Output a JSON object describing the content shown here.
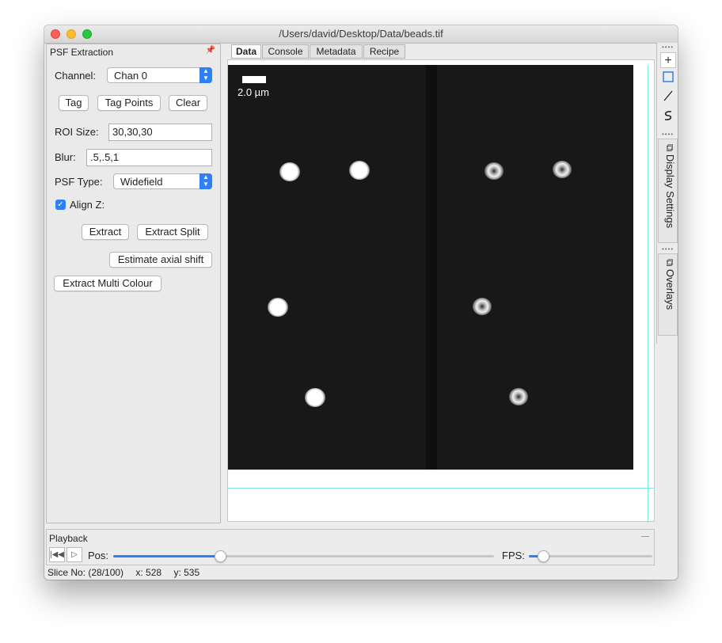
{
  "window": {
    "title": "/Users/david/Desktop/Data/beads.tif"
  },
  "psf_panel": {
    "title": "PSF Extraction",
    "pin_icon": "pin-icon",
    "channel_label": "Channel:",
    "channel_value": "Chan 0",
    "tag_label": "Tag",
    "tag_points_label": "Tag Points",
    "clear_label": "Clear",
    "roi_label": "ROI Size:",
    "roi_value": "30,30,30",
    "blur_label": "Blur:",
    "blur_value": ".5,.5,1",
    "psf_type_label": "PSF Type:",
    "psf_type_value": "Widefield",
    "align_z_label": "Align Z:",
    "align_z_checked": true,
    "extract_label": "Extract",
    "extract_split_label": "Extract Split",
    "estimate_label": "Estimate axial shift",
    "multi_colour_label": "Extract Multi Colour"
  },
  "tabs": [
    "Data",
    "Console",
    "Metadata",
    "Recipe"
  ],
  "active_tab": "Data",
  "image": {
    "scale_label": "2.0 µm"
  },
  "side_tools": [
    "crosshair-icon",
    "rectangle-icon",
    "line-icon",
    "curve-icon"
  ],
  "side_tabs": [
    "Display Settings",
    "Overlays"
  ],
  "playback": {
    "title": "Playback",
    "pos_label": "Pos:",
    "fps_label": "FPS:",
    "pos_fraction": 0.28
  },
  "status": {
    "slice": "Slice No: (28/100)",
    "x": "x: 528",
    "y": "y: 535"
  },
  "colors": {
    "accent": "#2f7ff5",
    "overlay_line": "#7fe8e3",
    "image_bg": "#181818"
  }
}
